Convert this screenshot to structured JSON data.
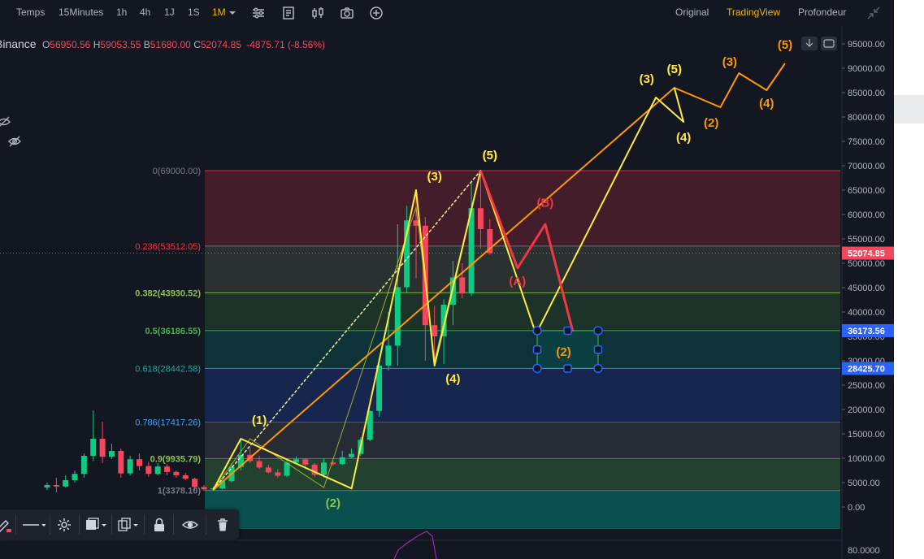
{
  "toolbar": {
    "intervals": [
      "Temps",
      "15Minutes",
      "1h",
      "4h",
      "1J",
      "1S",
      "1M"
    ],
    "active_interval": "1M",
    "views": [
      "Original",
      "TradingView",
      "Profondeur"
    ],
    "active_view": "TradingView",
    "icons": [
      "indicators-icon",
      "templates-icon",
      "candle-type-icon",
      "screenshot-icon",
      "add-icon",
      "fullscreen-icon"
    ]
  },
  "symbol": {
    "name": "Binance",
    "open_label": "O",
    "open": "56950.56",
    "high_label": "H",
    "high": "59053.55",
    "low_label": "B",
    "low": "51680.00",
    "close_label": "C",
    "close": "52074.85",
    "change": "-4875.71",
    "change_pct": "(-8.56%)"
  },
  "colors": {
    "up": "#0ecb81",
    "down": "#f6465d",
    "accent": "#f0b90b",
    "wave_orange": "#ff9800",
    "wave_yellow": "#ffeb3b",
    "correction_red": "#f23645"
  },
  "chart_data": {
    "type": "candlestick",
    "y_axis_labels": [
      "95000.00",
      "90000.00",
      "85000.00",
      "80000.00",
      "75000.00",
      "70000.00",
      "65000.00",
      "60000.00",
      "55000.00",
      "50000.00",
      "45000.00",
      "40000.00",
      "35000.00",
      "30000.00",
      "25000.00",
      "20000.00",
      "15000.00",
      "10000.00",
      "5000.00",
      "0.00"
    ],
    "ylim": [
      0,
      95000
    ],
    "lower_pane_label": "80.0000",
    "candles": [
      {
        "o": 4000,
        "c": 4500,
        "h": 5000,
        "l": 3500
      },
      {
        "o": 4500,
        "c": 4200,
        "h": 6000,
        "l": 3000
      },
      {
        "o": 4200,
        "c": 5500,
        "h": 6500,
        "l": 4000
      },
      {
        "o": 5500,
        "c": 6800,
        "h": 7500,
        "l": 5000
      },
      {
        "o": 6800,
        "c": 10500,
        "h": 11000,
        "l": 6000
      },
      {
        "o": 10500,
        "c": 14000,
        "h": 19800,
        "l": 9500
      },
      {
        "o": 14000,
        "c": 10300,
        "h": 17500,
        "l": 9000
      },
      {
        "o": 10300,
        "c": 11500,
        "h": 13000,
        "l": 9800
      },
      {
        "o": 11500,
        "c": 6900,
        "h": 12000,
        "l": 6000
      },
      {
        "o": 6900,
        "c": 9800,
        "h": 10500,
        "l": 6500
      },
      {
        "o": 9800,
        "c": 8400,
        "h": 11000,
        "l": 7500
      },
      {
        "o": 8400,
        "c": 6800,
        "h": 9300,
        "l": 6200
      },
      {
        "o": 6800,
        "c": 8300,
        "h": 9000,
        "l": 6500
      },
      {
        "o": 8300,
        "c": 7200,
        "h": 8800,
        "l": 6500
      },
      {
        "o": 7200,
        "c": 6500,
        "h": 7500,
        "l": 6000
      },
      {
        "o": 6500,
        "c": 5800,
        "h": 7000,
        "l": 5500
      },
      {
        "o": 5800,
        "c": 4100,
        "h": 6000,
        "l": 3300
      },
      {
        "o": 4100,
        "c": 3600,
        "h": 4500,
        "l": 3300
      },
      {
        "o": 3600,
        "c": 3800,
        "h": 4200,
        "l": 3400
      },
      {
        "o": 3800,
        "c": 5300,
        "h": 6000,
        "l": 3600
      },
      {
        "o": 5300,
        "c": 8200,
        "h": 9000,
        "l": 5000
      },
      {
        "o": 8200,
        "c": 10700,
        "h": 13800,
        "l": 7500
      },
      {
        "o": 10700,
        "c": 9400,
        "h": 12000,
        "l": 9000
      },
      {
        "o": 9400,
        "c": 8100,
        "h": 10500,
        "l": 7800
      },
      {
        "o": 8100,
        "c": 7100,
        "h": 8700,
        "l": 6900
      },
      {
        "o": 7100,
        "c": 6400,
        "h": 7800,
        "l": 6000
      },
      {
        "o": 6400,
        "c": 9100,
        "h": 10000,
        "l": 6100
      },
      {
        "o": 9100,
        "c": 9800,
        "h": 10400,
        "l": 8800
      },
      {
        "o": 9800,
        "c": 8700,
        "h": 10000,
        "l": 7800
      },
      {
        "o": 8700,
        "c": 6600,
        "h": 9000,
        "l": 6200
      },
      {
        "o": 6600,
        "c": 9100,
        "h": 10000,
        "l": 6000
      },
      {
        "o": 9100,
        "c": 8800,
        "h": 9500,
        "l": 8500
      },
      {
        "o": 8800,
        "c": 10200,
        "h": 11500,
        "l": 8600
      },
      {
        "o": 10200,
        "c": 10900,
        "h": 12000,
        "l": 10000
      },
      {
        "o": 10900,
        "c": 13800,
        "h": 14300,
        "l": 10500
      },
      {
        "o": 13800,
        "c": 19700,
        "h": 19800,
        "l": 13500
      },
      {
        "o": 19700,
        "c": 29000,
        "h": 29300,
        "l": 18500
      },
      {
        "o": 29000,
        "c": 33100,
        "h": 40000,
        "l": 28000
      },
      {
        "o": 33100,
        "c": 45100,
        "h": 58000,
        "l": 29000
      },
      {
        "o": 45100,
        "c": 58800,
        "h": 61800,
        "l": 44000
      },
      {
        "o": 58800,
        "c": 57700,
        "h": 64900,
        "l": 46900
      },
      {
        "o": 57700,
        "c": 37300,
        "h": 59500,
        "l": 30000
      },
      {
        "o": 37300,
        "c": 35000,
        "h": 41300,
        "l": 28800
      },
      {
        "o": 35000,
        "c": 41500,
        "h": 42600,
        "l": 29300
      },
      {
        "o": 41500,
        "c": 47100,
        "h": 50500,
        "l": 37300
      },
      {
        "o": 47100,
        "c": 43800,
        "h": 50000,
        "l": 42800
      },
      {
        "o": 43800,
        "c": 61300,
        "h": 66900,
        "l": 43300
      },
      {
        "o": 61300,
        "c": 57000,
        "h": 69000,
        "l": 53000
      },
      {
        "o": 57000,
        "c": 52074.85,
        "h": 59053.55,
        "l": 51680
      }
    ],
    "fib_levels": [
      {
        "label": "0(69000.00)",
        "value": 69000
      },
      {
        "label": "0.236(53512.05)",
        "value": 53512.05
      },
      {
        "label": "0.382(43930.52)",
        "value": 43930.52
      },
      {
        "label": "0.5(36186.55)",
        "value": 36186.55
      },
      {
        "label": "0.618(28442.58)",
        "value": 28442.58
      },
      {
        "label": "0.786(17417.26)",
        "value": 17417.26
      },
      {
        "label": "0.9(9935.79)",
        "value": 9935.79
      },
      {
        "label": "1(3378.10)",
        "value": 3378.1
      }
    ],
    "price_tags": [
      {
        "label": "52074.85",
        "value": 52074.85,
        "color": "#f6465d"
      },
      {
        "label": "36173.56",
        "value": 36173.56,
        "color": "#2962ff"
      },
      {
        "label": "28425.70",
        "value": 28425.7,
        "color": "#2962ff"
      }
    ],
    "yellow_wave": [
      {
        "i": 18,
        "v": 3500
      },
      {
        "i": 21,
        "v": 14000
      },
      {
        "i": 33,
        "v": 3800
      },
      {
        "i": 40,
        "v": 65000
      },
      {
        "i": 42,
        "v": 29000
      },
      {
        "i": 47,
        "v": 69000
      },
      {
        "i": 53,
        "v": 35500
      },
      {
        "i": 66,
        "v": 84000
      },
      {
        "i": 69,
        "v": 79000
      },
      {
        "i": 68,
        "v": 86000
      }
    ],
    "orange_wave": [
      {
        "i": 18,
        "v": 3500
      },
      {
        "i": 68,
        "v": 86000
      },
      {
        "i": 73,
        "v": 82000
      },
      {
        "i": 75,
        "v": 89000
      },
      {
        "i": 78,
        "v": 85500
      },
      {
        "i": 80,
        "v": 91000
      }
    ],
    "red_wave": [
      {
        "i": 47,
        "v": 69000
      },
      {
        "i": 51,
        "v": 49000
      },
      {
        "i": 54,
        "v": 58000
      },
      {
        "i": 57,
        "v": 36000
      }
    ],
    "wave_labels": [
      {
        "text": "(1)",
        "i": 23,
        "v": 17000,
        "color": "#ffeb3b"
      },
      {
        "text": "(2)",
        "i": 31,
        "v": 0,
        "color": "#8bc34a"
      },
      {
        "text": "(3)",
        "i": 42,
        "v": 67000,
        "color": "#ffeb3b"
      },
      {
        "text": "(4)",
        "i": 44,
        "v": 25500,
        "color": "#ffeb3b"
      },
      {
        "text": "(5)",
        "i": 48,
        "v": 71300,
        "color": "#ff9800"
      },
      {
        "text": "(5)",
        "i": 48,
        "v": 71300,
        "color": "#ffeb3b"
      },
      {
        "text": "(A)",
        "i": 51,
        "v": 45500,
        "color": "#f23645"
      },
      {
        "text": "(B)",
        "i": 54,
        "v": 61600,
        "color": "#f23645"
      },
      {
        "text": "(2)",
        "i": 56,
        "v": 31000,
        "color": "#ff9800"
      },
      {
        "text": "(3)",
        "i": 65,
        "v": 87000,
        "color": "#ffeb3b"
      },
      {
        "text": "(5)",
        "i": 68,
        "v": 89000,
        "color": "#ff9800"
      },
      {
        "text": "(5)",
        "i": 68,
        "v": 89000,
        "color": "#ffeb3b"
      },
      {
        "text": "(4)",
        "i": 69,
        "v": 75000,
        "color": "#ffeb3b"
      },
      {
        "text": "(2)",
        "i": 72,
        "v": 78000,
        "color": "#ff9800"
      },
      {
        "text": "(3)",
        "i": 74,
        "v": 90500,
        "color": "#ff9800"
      },
      {
        "text": "(4)",
        "i": 78,
        "v": 82000,
        "color": "#ff9800"
      },
      {
        "text": "(5)",
        "i": 80,
        "v": 94000,
        "color": "#ff9800"
      }
    ]
  },
  "drawing_toolbar": {
    "tools": [
      "draw-tool-icon",
      "line-style-icon",
      "settings-icon",
      "template-icon",
      "clone-icon",
      "lock-icon",
      "visibility-icon",
      "delete-icon"
    ]
  }
}
